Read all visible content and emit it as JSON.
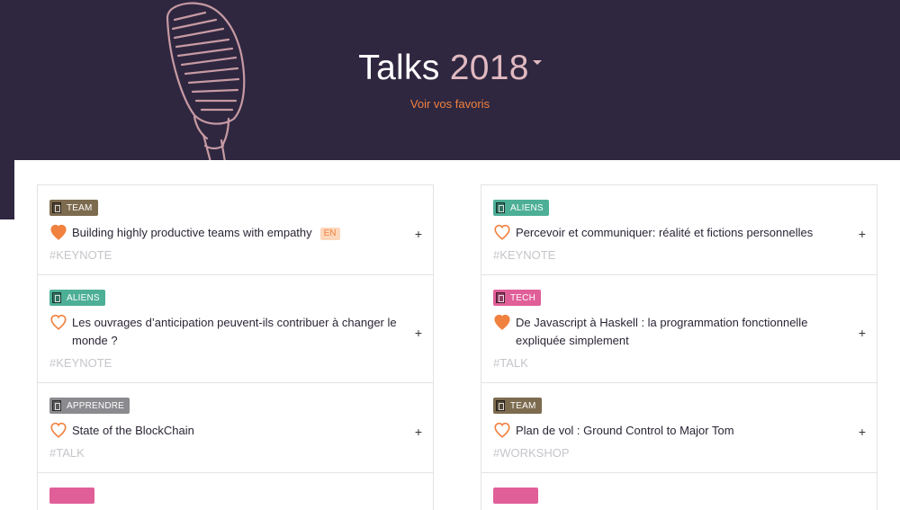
{
  "header": {
    "title": "Talks",
    "year": "2018",
    "favorites_link": "Voir vos favoris"
  },
  "colors": {
    "background": "#2f2740",
    "accent": "#f0813f",
    "year": "#e0b9c0",
    "tag_team": "#7d6b4f",
    "tag_aliens": "#4daf96",
    "tag_tech": "#e05f99",
    "tag_apprendre": "#8b8a8e"
  },
  "columns": {
    "left": [
      {
        "tag": "TEAM",
        "tag_icon": "team-icon",
        "favorite": true,
        "title": "Building highly productive teams with empathy",
        "lang": "EN",
        "hashtag": "#KEYNOTE"
      },
      {
        "tag": "ALIENS",
        "tag_icon": "aliens-icon",
        "favorite": false,
        "title": "Les ouvrages d’anticipation peuvent-ils contribuer à changer le monde ?",
        "lang": "",
        "hashtag": "#KEYNOTE"
      },
      {
        "tag": "APPRENDRE",
        "tag_icon": "book-icon",
        "favorite": false,
        "title": "State of the BlockChain",
        "lang": "",
        "hashtag": "#TALK"
      }
    ],
    "right": [
      {
        "tag": "ALIENS",
        "tag_icon": "aliens-icon",
        "favorite": false,
        "title": "Percevoir et communiquer: réalité et fictions personnelles",
        "lang": "",
        "hashtag": "#KEYNOTE"
      },
      {
        "tag": "TECH",
        "tag_icon": "tech-icon",
        "favorite": true,
        "title": "De Javascript à Haskell : la programmation fonctionnelle expliquée simplement",
        "lang": "",
        "hashtag": "#TALK"
      },
      {
        "tag": "TEAM",
        "tag_icon": "team-icon",
        "favorite": false,
        "title": "Plan de vol : Ground Control to Major Tom",
        "lang": "",
        "hashtag": "#WORKSHOP"
      }
    ]
  },
  "actions": {
    "expand_label": "+"
  }
}
